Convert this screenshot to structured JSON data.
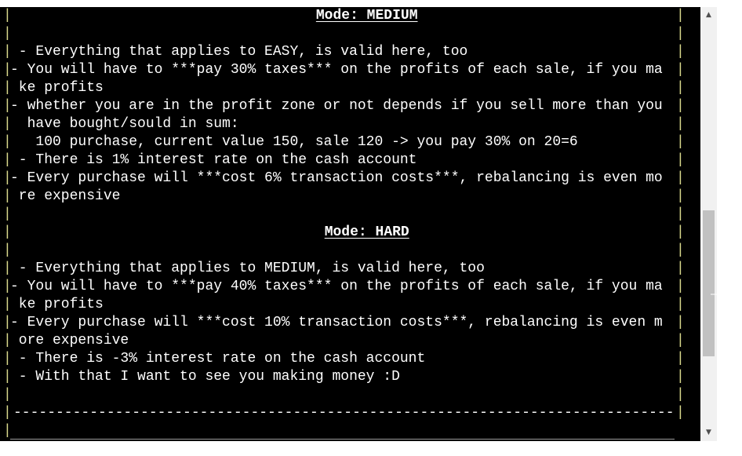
{
  "terminal": {
    "lines": [
      {
        "kind": "title",
        "text": "Mode: MEDIUM",
        "col": 36
      },
      {
        "kind": "blank"
      },
      {
        "kind": "text",
        "text": " - Everything that applies to EASY, is valid here, too"
      },
      {
        "kind": "text",
        "text": "- You will have to ***pay 30% taxes*** on the profits of each sale, if you ma"
      },
      {
        "kind": "text",
        "text": " ke profits"
      },
      {
        "kind": "text",
        "text": "- whether you are in the profit zone or not depends if you sell more than you"
      },
      {
        "kind": "text",
        "text": "  have bought/sould in sum:"
      },
      {
        "kind": "text",
        "text": "   100 purchase, current value 150, sale 120 -> you pay 30% on 20=6"
      },
      {
        "kind": "text",
        "text": " - There is 1% interest rate on the cash account"
      },
      {
        "kind": "text",
        "text": "- Every purchase will ***cost 6% transaction costs***, rebalancing is even mo"
      },
      {
        "kind": "text",
        "text": " re expensive"
      },
      {
        "kind": "blank"
      },
      {
        "kind": "title",
        "text": "Mode: HARD",
        "col": 37
      },
      {
        "kind": "blank"
      },
      {
        "kind": "text",
        "text": " - Everything that applies to MEDIUM, is valid here, too"
      },
      {
        "kind": "text",
        "text": "- You will have to ***pay 40% taxes*** on the profits of each sale, if you ma"
      },
      {
        "kind": "text",
        "text": " ke profits"
      },
      {
        "kind": "text",
        "text": "- Every purchase will ***cost 10% transaction costs***, rebalancing is even m"
      },
      {
        "kind": "text",
        "text": " ore expensive"
      },
      {
        "kind": "text",
        "text": " - There is -3% interest rate on the cash account"
      },
      {
        "kind": "text",
        "text": " - With that I want to see you making money :D"
      },
      {
        "kind": "blank"
      },
      {
        "kind": "divider",
        "text": "--------------------------------------------------------------------------------"
      },
      {
        "kind": "blank"
      }
    ]
  },
  "scrollbar": {
    "up_icon": "triangle-up-icon",
    "down_icon": "triangle-down-icon",
    "position": 0.73
  },
  "colors": {
    "background": "#000000",
    "text": "#ffffff",
    "border_pipe": "#d9d98c",
    "scrollbar_track": "#f1f1f1",
    "scrollbar_thumb": "#c1c1c1"
  }
}
